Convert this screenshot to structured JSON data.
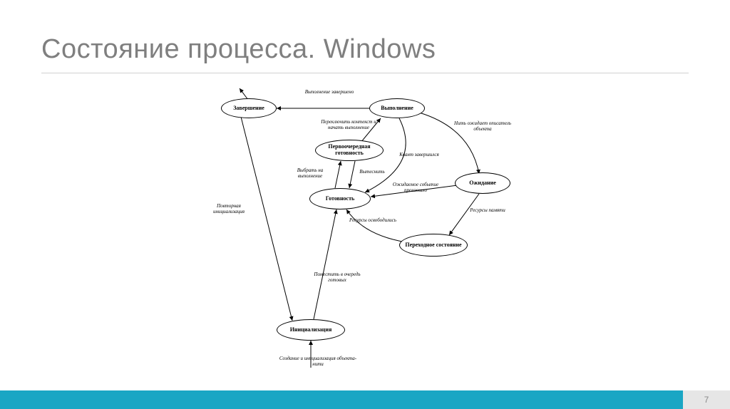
{
  "title": "Состояние процесса. Windows",
  "page_number": "7",
  "states": {
    "termination": "Завершение",
    "execution": "Выполнение",
    "priority_ready": "Первоочередная готовность",
    "ready": "Готовность",
    "waiting": "Ожидание",
    "transition": "Переходное состояние",
    "initialization": "Инициализация"
  },
  "edges": {
    "exec_done": "Выполнение завершено",
    "switch_context": "Переключить контекст и начать выполнение",
    "thread_waits": "Нить ожидает описатель объекта",
    "quantum_done": "Квант завершился",
    "select_exec": "Выбрать на выполнение",
    "preempt": "Вытеснить",
    "event_occurred": "Ожидаемое событие произошло",
    "resources_freed": "Ресурсы освободились",
    "memory_resources": "Ресурсы памяти",
    "reinit": "Повторная инициализация",
    "enqueue": "Поместить в очередь готовых",
    "create_init": "Создание и инициализация объекта-нити"
  }
}
